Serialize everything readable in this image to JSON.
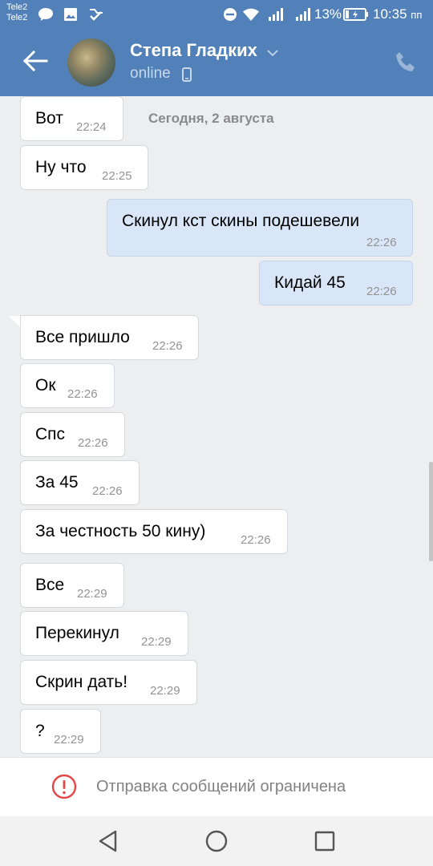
{
  "status_bar": {
    "carriers": [
      "Tele2",
      "Tele2"
    ],
    "battery": "13%",
    "time": "10:35",
    "time_suffix": "пп",
    "icons": [
      "message-icon",
      "image-icon",
      "check-icon",
      "dnd-icon",
      "wifi-icon",
      "signal-icon",
      "signal-icon",
      "battery-charging-icon"
    ]
  },
  "header": {
    "name": "Степа Гладких",
    "status": "online",
    "icons": [
      "back-arrow-icon",
      "chevron-down-icon",
      "mobile-phone-icon",
      "call-icon"
    ]
  },
  "date_separator": "Сегодня, 2 августа",
  "messages": [
    {
      "text": "Вот",
      "time": "22:24",
      "direction": "in"
    },
    {
      "text": "Ну что",
      "time": "22:25",
      "direction": "in"
    },
    {
      "text": "Скинул кст скины подешевели",
      "time": "22:26",
      "direction": "out"
    },
    {
      "text": "Кидай 45",
      "time": "22:26",
      "direction": "out"
    },
    {
      "text": "Все пришло",
      "time": "22:26",
      "direction": "in"
    },
    {
      "text": "Ок",
      "time": "22:26",
      "direction": "in"
    },
    {
      "text": "Спс",
      "time": "22:26",
      "direction": "in"
    },
    {
      "text": "За 45",
      "time": "22:26",
      "direction": "in"
    },
    {
      "text": "За честность 50 кину)",
      "time": "22:26",
      "direction": "in"
    },
    {
      "text": "Все",
      "time": "22:29",
      "direction": "in"
    },
    {
      "text": "Перекинул",
      "time": "22:29",
      "direction": "in"
    },
    {
      "text": "Скрин дать!",
      "time": "22:29",
      "direction": "in"
    },
    {
      "text": "?",
      "time": "22:29",
      "direction": "in"
    }
  ],
  "restriction": {
    "text": "Отправка сообщений ограничена",
    "icon": "warning-circle-icon",
    "color": "#e64646"
  },
  "nav": {
    "icons": [
      "back-triangle-icon",
      "home-circle-icon",
      "recents-square-icon"
    ]
  },
  "colors": {
    "header": "#5181b8",
    "background": "#edeef0",
    "incoming_bubble": "#ffffff",
    "outgoing_bubble": "#d9e6f7"
  }
}
